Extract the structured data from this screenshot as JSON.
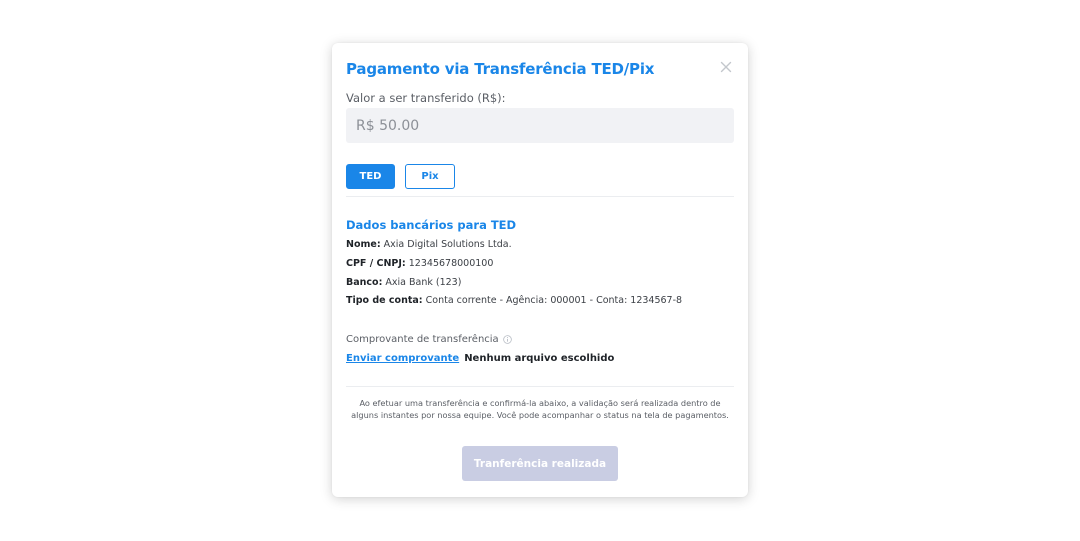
{
  "modal": {
    "title": "Pagamento via Transferência TED/Pix",
    "close_icon": "close-icon"
  },
  "amount": {
    "label": "Valor a ser transferido (R$):",
    "value": "R$ 50.00"
  },
  "tabs": [
    {
      "label": "TED",
      "active": true
    },
    {
      "label": "Pix",
      "active": false
    }
  ],
  "bank": {
    "title": "Dados bancários para TED",
    "rows": [
      {
        "key": "Nome:",
        "value": "Axia Digital Solutions Ltda."
      },
      {
        "key": "CPF / CNPJ:",
        "value": "12345678000100"
      },
      {
        "key": "Banco:",
        "value": "Axia Bank (123)"
      },
      {
        "key": "Tipo de conta:",
        "value": "Conta corrente - Agência: 000001 - Conta: 1234567-8"
      }
    ]
  },
  "receipt": {
    "label": "Comprovante de transferência",
    "info_icon": "info-icon",
    "upload_link": "Enviar comprovante",
    "file_status": "Nenhum arquivo escolhido"
  },
  "note": "Ao efetuar uma transferência e confirmá-la abaixo, a validação será realizada dentro de alguns instantes por nossa equipe. Você pode acompanhar o status na tela de pagamentos.",
  "submit_label": "Tranferência realizada",
  "colors": {
    "accent": "#1a86e8",
    "input_bg": "#f1f2f5",
    "disabled_button": "#c9cde3"
  }
}
